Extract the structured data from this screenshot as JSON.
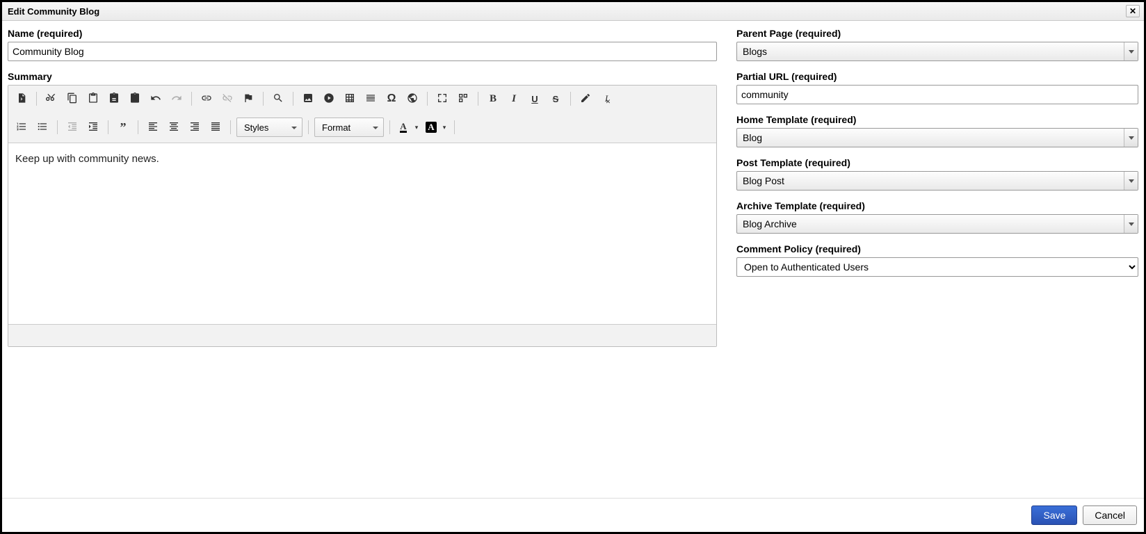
{
  "dialog": {
    "title": "Edit Community Blog"
  },
  "left": {
    "name_label": "Name (required)",
    "name_value": "Community Blog",
    "summary_label": "Summary",
    "summary_content": "Keep up with community news.",
    "toolbar": {
      "styles_label": "Styles",
      "format_label": "Format"
    }
  },
  "right": {
    "parent_label": "Parent Page (required)",
    "parent_value": "Blogs",
    "url_label": "Partial URL (required)",
    "url_value": "community",
    "home_tpl_label": "Home Template (required)",
    "home_tpl_value": "Blog",
    "post_tpl_label": "Post Template (required)",
    "post_tpl_value": "Blog Post",
    "archive_tpl_label": "Archive Template (required)",
    "archive_tpl_value": "Blog Archive",
    "comment_label": "Comment Policy (required)",
    "comment_value": "Open to Authenticated Users"
  },
  "footer": {
    "save": "Save",
    "cancel": "Cancel"
  }
}
